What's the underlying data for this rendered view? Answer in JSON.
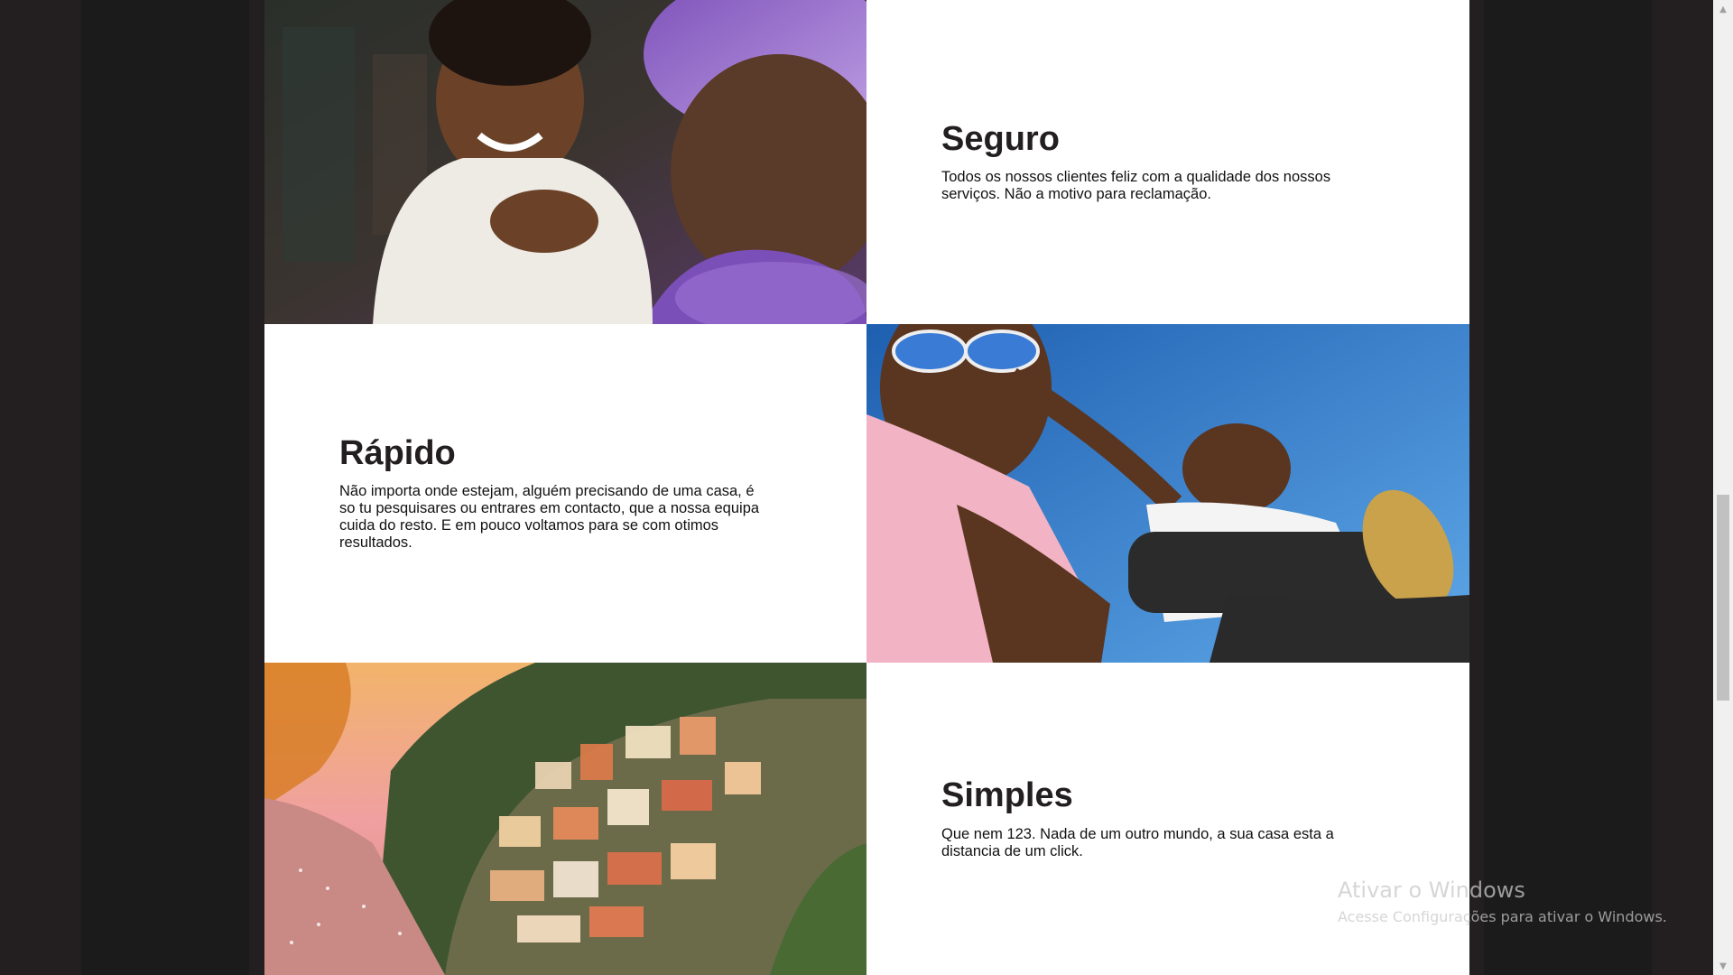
{
  "features": [
    {
      "title": "Seguro",
      "description": "Todos os nossos clientes feliz com a qualidade dos nossos serviços. Não a motivo para reclamação.",
      "image_icon": "mother-child-photo"
    },
    {
      "title": "Rápido",
      "description": "Não importa onde estejam, alguém precisando de uma casa, é so tu pesquisares ou entrares em contacto, que a nossa equipa cuida do resto. E em pouco voltamos para se com otimos resultados.",
      "image_icon": "father-child-photo"
    },
    {
      "title": "Simples",
      "description": "Que nem 123. Nada de um outro mundo, a sua casa esta a distancia de um click.",
      "image_icon": "coastal-town-photo"
    }
  ],
  "watermark": {
    "title": "Ativar o Windows",
    "subtitle": "Acesse Configurações para ativar o Windows."
  },
  "colors": {
    "background": "#231f20",
    "side_panel": "#1b1b1b",
    "card": "#ffffff",
    "heading": "#231f20"
  }
}
